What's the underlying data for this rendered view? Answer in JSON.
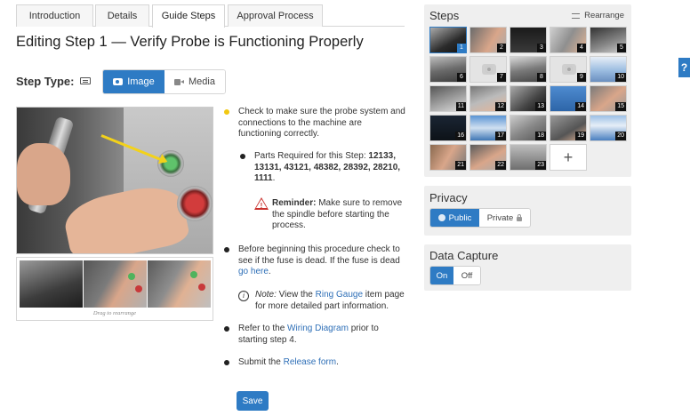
{
  "tabs": [
    {
      "label": "Introduction"
    },
    {
      "label": "Details"
    },
    {
      "label": "Guide Steps",
      "active": true
    },
    {
      "label": "Approval Process"
    }
  ],
  "page_title": "Editing Step 1 — Verify Probe is Functioning Properly",
  "step_type": {
    "label": "Step Type:",
    "options": [
      {
        "label": "Image",
        "selected": true,
        "icon": "camera-icon"
      },
      {
        "label": "Media",
        "selected": false,
        "icon": "video-icon"
      }
    ]
  },
  "media": {
    "drag_hint": "Drag to rearrange"
  },
  "content": {
    "item1": "Check to make sure the probe system and connections to the machine are functioning correctly.",
    "parts_prefix": "Parts Required for this Step: ",
    "parts_bold": "12133, 13131, 43121, 48382, 28392, 28210, 1111",
    "parts_suffix": ".",
    "reminder_bold": "Reminder:",
    "reminder_text": " Make sure to remove the spindle before starting the process.",
    "item2_text": "Before beginning this procedure check to see if the fuse is dead. If the fuse is dead ",
    "item2_link": "go here",
    "item2_end": ".",
    "note_label": "Note:",
    "note_pre": " View the ",
    "note_link": "Ring Gauge",
    "note_post": " item page for more detailed part information.",
    "item3_pre": "Refer to the ",
    "item3_link": "Wiring Diagram",
    "item3_post": " prior to starting step 4.",
    "item4_pre": "Submit the ",
    "item4_link": "Release form",
    "item4_post": "."
  },
  "save_label": "Save",
  "steps_panel": {
    "title": "Steps",
    "rearrange_label": "Rearrange",
    "numbers": [
      "1",
      "2",
      "3",
      "4",
      "5",
      "6",
      "7",
      "8",
      "9",
      "10",
      "11",
      "12",
      "13",
      "14",
      "15",
      "16",
      "17",
      "18",
      "19",
      "20",
      "21",
      "22",
      "23"
    ],
    "add_label": "+"
  },
  "privacy": {
    "title": "Privacy",
    "public_label": "Public",
    "private_label": "Private"
  },
  "data_capture": {
    "title": "Data Capture",
    "on_label": "On",
    "off_label": "Off"
  },
  "help_label": "?",
  "colors": {
    "accent": "#2e7bc4",
    "bullet_highlight": "#f2c811",
    "warning": "#c9302c",
    "link": "#2e6fb7"
  }
}
